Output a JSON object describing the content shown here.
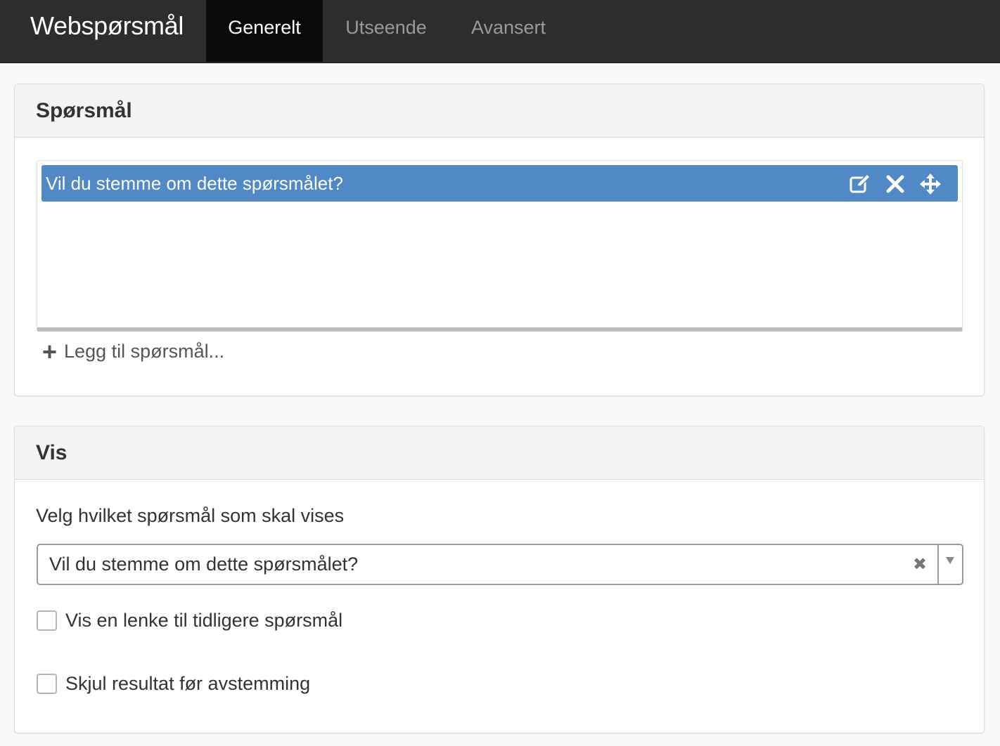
{
  "app": {
    "title": "Webspørsmål"
  },
  "tabs": [
    {
      "label": "Generelt",
      "active": true
    },
    {
      "label": "Utseende",
      "active": false
    },
    {
      "label": "Avansert",
      "active": false
    }
  ],
  "questions_panel": {
    "heading": "Spørsmål",
    "items": [
      {
        "text": "Vil du stemme om dette spørsmålet?",
        "selected": true,
        "actions": [
          "edit-icon",
          "close-icon",
          "move-icon"
        ]
      }
    ],
    "add_label": "Legg til spørsmål...",
    "add_icon": "plus-icon"
  },
  "display_panel": {
    "heading": "Vis",
    "select_label": "Velg hvilket spørsmål som skal vises",
    "select_value": "Vil du stemme om dette spørsmålet?",
    "clear_glyph": "✖",
    "checkboxes": [
      {
        "label": "Vis en lenke til tidligere spørsmål",
        "checked": false
      },
      {
        "label": "Skjul resultat før avstemming",
        "checked": false
      }
    ]
  },
  "colors": {
    "topbar": "#2d2d2d",
    "active_tab": "#0a0a0a",
    "selected_item": "#5089c6",
    "panel_heading": "#f4f4f4"
  }
}
